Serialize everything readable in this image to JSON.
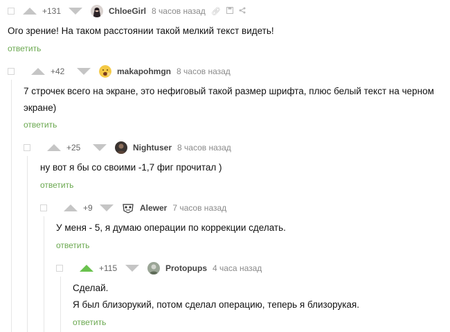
{
  "comments": [
    {
      "rating": "+131",
      "username": "ChloeGirl",
      "time": "8 часов назад",
      "text": "Ого зрение! На таком расстоянии такой мелкий текст видеть!",
      "reply": "ответить",
      "avatar_icon": "woman-portrait-icon"
    },
    {
      "rating": "+42",
      "username": "makapohmgn",
      "time": "8 часов назад",
      "text": "7 строчек всего на экране, это нефиговый такой размер шрифта, плюс белый текст на черном экране)",
      "reply": "ответить",
      "avatar_icon": "yawning-emoji-icon"
    },
    {
      "rating": "+25",
      "username": "Nightuser",
      "time": "8 часов назад",
      "text": "ну вот я бы со своими -1,7 фиг прочитал )",
      "reply": "ответить",
      "avatar_icon": "dark-portrait-icon"
    },
    {
      "rating": "+9",
      "username": "Alewer",
      "time": "7 часов назад",
      "text": "У меня - 5, я думаю операции по коррекции сделать.",
      "reply": "ответить",
      "avatar_icon": "mask-avatar-icon"
    },
    {
      "rating": "+115",
      "username": "Protopups",
      "time": "4 часа назад",
      "text_lines": [
        "Сделай.",
        "Я был близорукий, потом сделал операцию, теперь я близорукая."
      ],
      "reply": "ответить",
      "avatar_icon": "green-portrait-icon"
    }
  ],
  "colors": {
    "upvote_active": "#6ac24e",
    "reply_link": "#6aa84f",
    "vote_inactive": "#c5c5c5"
  }
}
